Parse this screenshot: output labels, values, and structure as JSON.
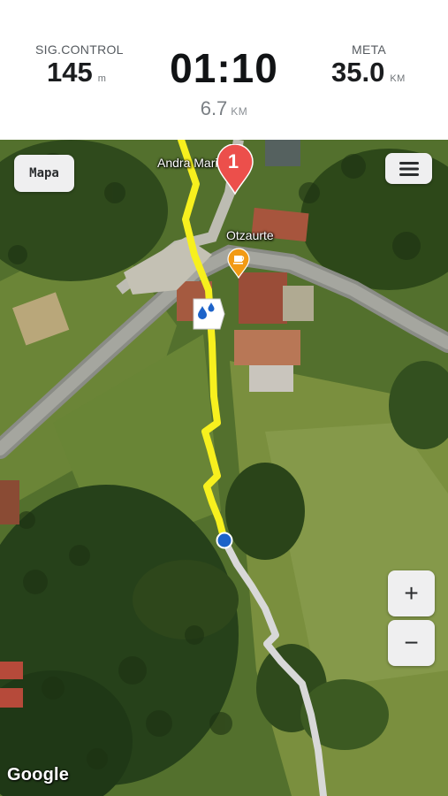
{
  "header": {
    "left": {
      "label": "SIG.CONTROL",
      "value": "145",
      "unit": "m"
    },
    "center": {
      "time": "01:10",
      "distance": "6.7",
      "distance_unit": "KM"
    },
    "right": {
      "label": "META",
      "value": "35.0",
      "unit": "KM"
    }
  },
  "map": {
    "map_type_button": "Mapa",
    "labels": {
      "church": "Andra Mari Eliza",
      "cafe": "Otzaurte"
    },
    "checkpoint_marker": "1",
    "zoom_in": "+",
    "zoom_out": "−",
    "attribution": "Google",
    "colors": {
      "route_done": "#f7f01e",
      "route_remaining": "#d8d8d8",
      "position_dot": "#1d63c9",
      "checkpoint": "#ec4f4b",
      "cafe_poi": "#f29a14"
    },
    "icons": [
      "hamburger-menu-icon",
      "water-drop-icon",
      "coffee-cup-icon",
      "location-pin-icon"
    ]
  }
}
